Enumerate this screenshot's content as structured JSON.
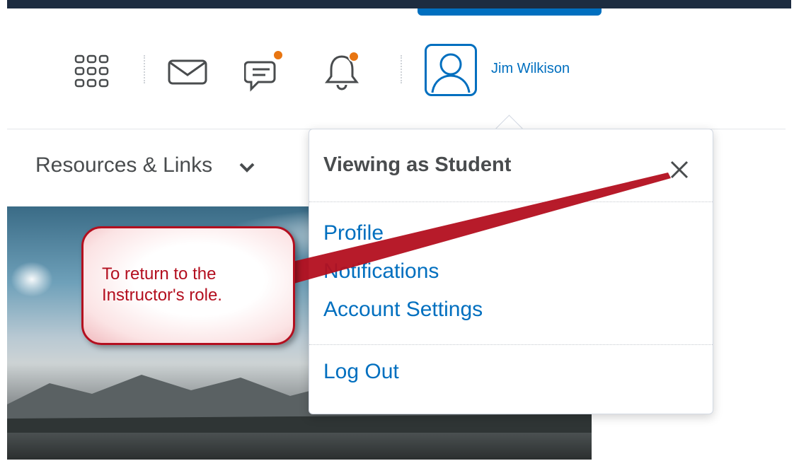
{
  "header": {
    "username": "Jim Wilkison",
    "icons": [
      "apps-grid-icon",
      "mail-icon",
      "chat-icon",
      "bell-icon",
      "avatar-icon"
    ]
  },
  "nav": {
    "resources_label": "Resources & Links"
  },
  "dropdown": {
    "title": "Viewing as Student",
    "items": [
      "Profile",
      "Notifications",
      "Account Settings"
    ],
    "logout": "Log Out"
  },
  "annotation": {
    "line1": "To return to the",
    "line2": "Instructor's role."
  },
  "colors": {
    "accent": "#006fbf",
    "badge": "#e87511",
    "callout": "#b30f1f"
  }
}
